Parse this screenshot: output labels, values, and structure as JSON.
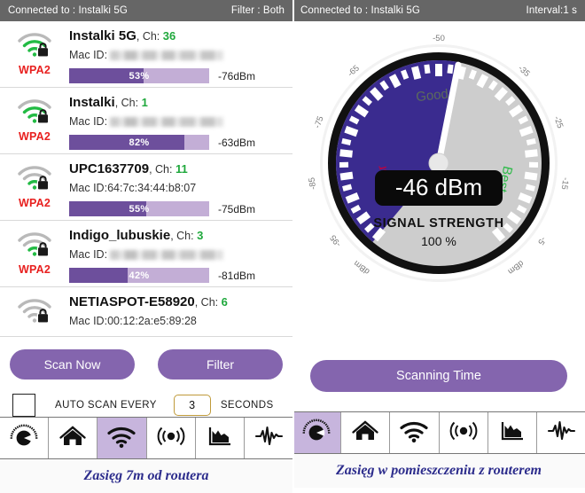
{
  "left": {
    "statusbar": {
      "connected": "Connected to : Instalki 5G",
      "filter": "Filter : Both"
    },
    "networks": [
      {
        "ssid": "Instalki 5G",
        "ch_label": "Ch:",
        "channel": "36",
        "mac_label": "Mac ID:",
        "mac": "",
        "mac_hidden": true,
        "security": "WPA2",
        "percent_text": "53%",
        "percent": 53,
        "dbm": "-76dBm",
        "locked": true,
        "signal_strength": 2
      },
      {
        "ssid": "Instalki",
        "ch_label": "Ch:",
        "channel": "1",
        "mac_label": "Mac ID:",
        "mac": "",
        "mac_hidden": true,
        "security": "WPA2",
        "percent_text": "82%",
        "percent": 82,
        "dbm": "-63dBm",
        "locked": true,
        "signal_strength": 2
      },
      {
        "ssid": "UPC1637709",
        "ch_label": "Ch:",
        "channel": "11",
        "mac_label": "Mac ID:",
        "mac": "64:7c:34:44:b8:07",
        "mac_hidden": false,
        "security": "WPA2",
        "percent_text": "55%",
        "percent": 55,
        "dbm": "-75dBm",
        "locked": true,
        "signal_strength": 1
      },
      {
        "ssid": "Indigo_lubuskie",
        "ch_label": "Ch:",
        "channel": "3",
        "mac_label": "Mac ID:",
        "mac": "",
        "mac_hidden": true,
        "security": "WPA2",
        "percent_text": "42%",
        "percent": 42,
        "dbm": "-81dBm",
        "locked": true,
        "signal_strength": 1
      },
      {
        "ssid": "NETIASPOT-E58920",
        "ch_label": "Ch:",
        "channel": "6",
        "mac_label": "Mac ID:",
        "mac": "00:12:2a:e5:89:28",
        "mac_hidden": false,
        "security": "",
        "percent_text": "",
        "percent": 0,
        "dbm": "",
        "locked": true,
        "signal_strength": 0
      }
    ],
    "controls": {
      "scan_now": "Scan Now",
      "filter": "Filter",
      "auto_scan_label": "AUTO SCAN EVERY",
      "interval_value": "3",
      "seconds_label": "SECONDS",
      "auto_scan_checked": false
    },
    "caption": "Zasięg 7m od routera"
  },
  "right": {
    "statusbar": {
      "connected": "Connected to : Instalki 5G",
      "interval": "Interval:1 s"
    },
    "gauge": {
      "value_text": "-46 dBm",
      "title": "SIGNAL STRENGTH",
      "percent_text": "100 %",
      "zone_poor": "Poor",
      "zone_good": "Good",
      "zone_best": "Best",
      "tick_labels_left": [
        "-50",
        "-65",
        "-75",
        "-85",
        "-95",
        "dBm"
      ],
      "tick_labels_right": [
        "-35",
        "-25",
        "-15",
        "-5",
        "dBm"
      ],
      "needle_value": -46,
      "fill_color": "#3a2b8f",
      "dial_color": "#cdcdcd",
      "rim_color": "#111111"
    },
    "scanning_time": "Scanning Time",
    "caption": "Zasięg w pomieszczeniu z routerem"
  },
  "tabs": [
    {
      "icon": "gauge-icon",
      "active_left": false,
      "active_right": true
    },
    {
      "icon": "home-icon",
      "active_left": false,
      "active_right": false
    },
    {
      "icon": "wifi-icon",
      "active_left": true,
      "active_right": false
    },
    {
      "icon": "radar-icon",
      "active_left": false,
      "active_right": false
    },
    {
      "icon": "chart-icon",
      "active_left": false,
      "active_right": false
    },
    {
      "icon": "waveform-icon",
      "active_left": false,
      "active_right": false
    }
  ],
  "colors": {
    "accent_purple": "#8465ae",
    "bar_fill": "#6d4f9c",
    "bar_track": "#c3aed6",
    "status_gray": "#666666",
    "channel_green": "#1fa83c",
    "security_red": "#e8201f",
    "caption_blue": "#2c2c8c"
  }
}
